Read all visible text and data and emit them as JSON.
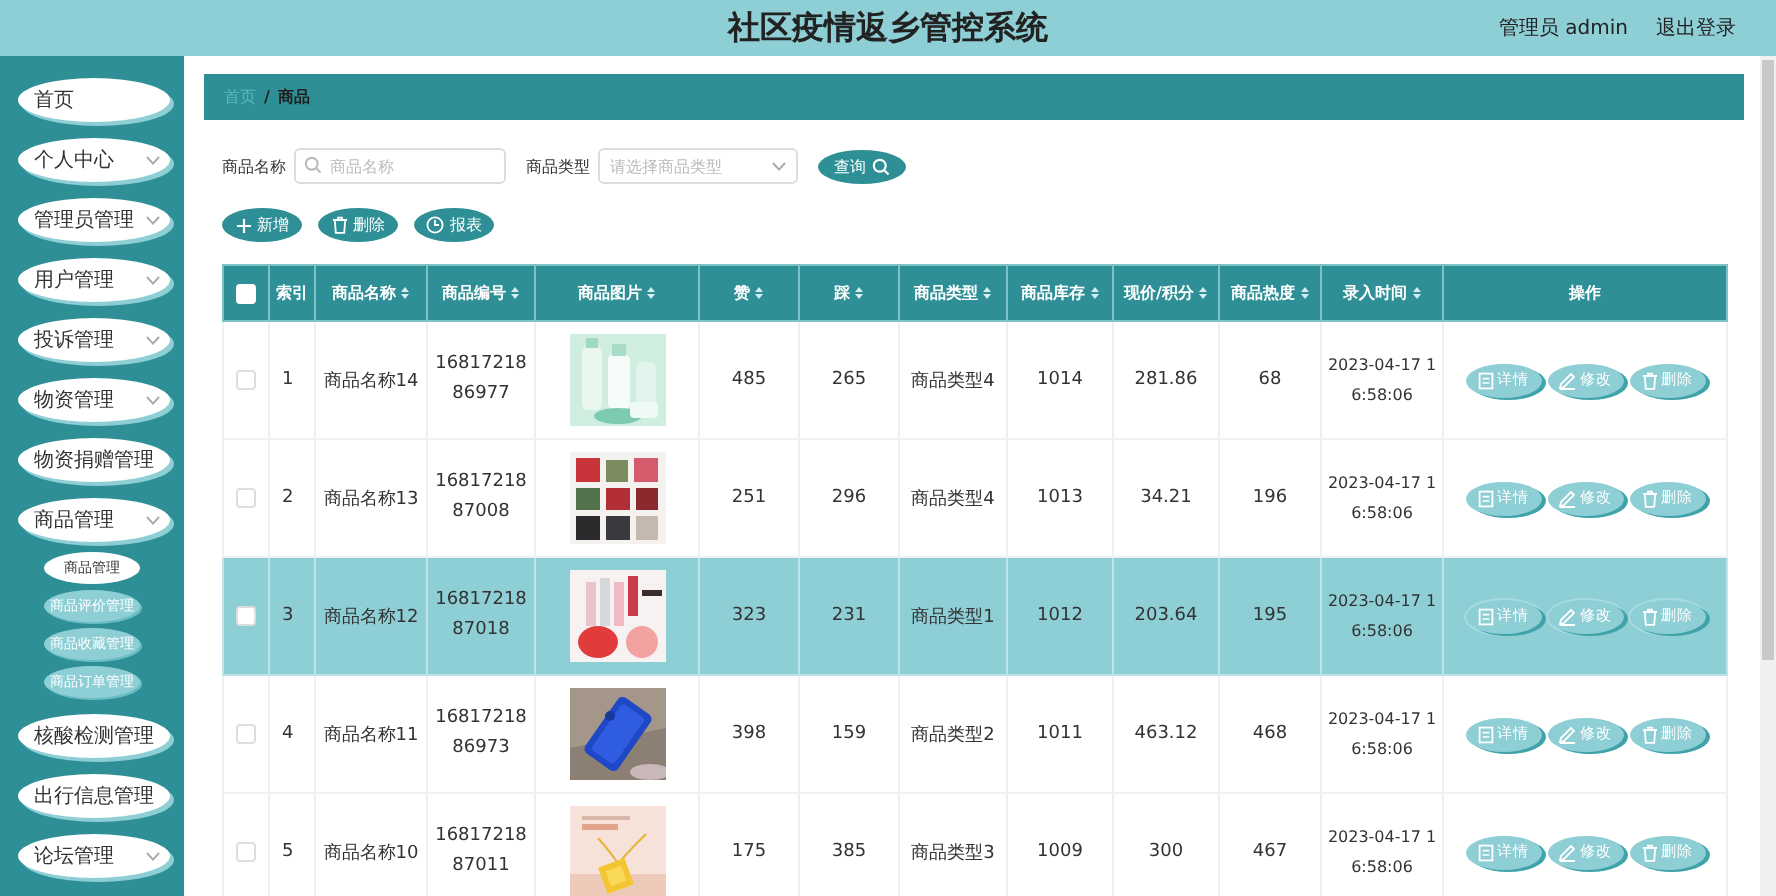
{
  "header": {
    "title": "社区疫情返乡管控系统",
    "user": "管理员 admin",
    "logout": "退出登录"
  },
  "sidebar": {
    "items": [
      {
        "label": "首页",
        "has_submenu": false
      },
      {
        "label": "个人中心",
        "has_submenu": true
      },
      {
        "label": "管理员管理",
        "has_submenu": true
      },
      {
        "label": "用户管理",
        "has_submenu": true
      },
      {
        "label": "投诉管理",
        "has_submenu": true
      },
      {
        "label": "物资管理",
        "has_submenu": true
      },
      {
        "label": "物资捐赠管理",
        "has_submenu": false
      },
      {
        "label": "商品管理",
        "has_submenu": true,
        "children": [
          {
            "label": "商品管理",
            "selected": true
          },
          {
            "label": "商品评价管理",
            "selected": false
          },
          {
            "label": "商品收藏管理",
            "selected": false
          },
          {
            "label": "商品订单管理",
            "selected": false
          }
        ]
      },
      {
        "label": "核酸检测管理",
        "has_submenu": false
      },
      {
        "label": "出行信息管理",
        "has_submenu": false
      },
      {
        "label": "论坛管理",
        "has_submenu": true
      }
    ]
  },
  "breadcrumb": {
    "items": [
      "首页",
      "商品"
    ],
    "separator": "/"
  },
  "search": {
    "name_label": "商品名称",
    "name_placeholder": "商品名称",
    "type_label": "商品类型",
    "type_placeholder": "请选择商品类型",
    "query_button": "查询"
  },
  "toolbar": [
    {
      "kind": "add",
      "label": "新增"
    },
    {
      "kind": "delete",
      "label": "删除"
    },
    {
      "kind": "report",
      "label": "报表"
    }
  ],
  "table": {
    "select_all_checked": false,
    "columns": [
      {
        "label": "索引",
        "sortable": false
      },
      {
        "label": "商品名称",
        "sortable": true
      },
      {
        "label": "商品编号",
        "sortable": true
      },
      {
        "label": "商品图片",
        "sortable": true
      },
      {
        "label": "赞",
        "sortable": true
      },
      {
        "label": "踩",
        "sortable": true
      },
      {
        "label": "商品类型",
        "sortable": true
      },
      {
        "label": "商品库存",
        "sortable": true
      },
      {
        "label": "现价/积分",
        "sortable": true
      },
      {
        "label": "商品热度",
        "sortable": true
      },
      {
        "label": "录入时间",
        "sortable": true
      },
      {
        "label": "操作",
        "sortable": false
      }
    ],
    "rows": [
      {
        "selected": false,
        "checked": false,
        "index": "1",
        "name": "商品名称14",
        "code": "1681721886977",
        "image": {
          "kind": "picture"
        },
        "likes": "485",
        "dislikes": "265",
        "type": "商品类型4",
        "stock": "1014",
        "price": "281.86",
        "heat": "68",
        "time": "2023-04-17 16:58:06",
        "actions": [
          {
            "kind": "view",
            "label": "详情"
          },
          {
            "kind": "edit",
            "label": "修改"
          },
          {
            "kind": "delete",
            "label": "删除"
          }
        ]
      },
      {
        "selected": false,
        "checked": false,
        "index": "2",
        "name": "商品名称13",
        "code": "1681721887008",
        "image": {
          "kind": "picture"
        },
        "likes": "251",
        "dislikes": "296",
        "type": "商品类型4",
        "stock": "1013",
        "price": "34.21",
        "heat": "196",
        "time": "2023-04-17 16:58:06",
        "actions": [
          {
            "kind": "view",
            "label": "详情"
          },
          {
            "kind": "edit",
            "label": "修改"
          },
          {
            "kind": "delete",
            "label": "删除"
          }
        ]
      },
      {
        "selected": true,
        "checked": false,
        "index": "3",
        "name": "商品名称12",
        "code": "1681721887018",
        "image": {
          "kind": "picture"
        },
        "likes": "323",
        "dislikes": "231",
        "type": "商品类型1",
        "stock": "1012",
        "price": "203.64",
        "heat": "195",
        "time": "2023-04-17 16:58:06",
        "actions": [
          {
            "kind": "view",
            "label": "详情"
          },
          {
            "kind": "edit",
            "label": "修改"
          },
          {
            "kind": "delete",
            "label": "删除"
          }
        ]
      },
      {
        "selected": false,
        "checked": false,
        "index": "4",
        "name": "商品名称11",
        "code": "1681721886973",
        "image": {
          "kind": "picture"
        },
        "likes": "398",
        "dislikes": "159",
        "type": "商品类型2",
        "stock": "1011",
        "price": "463.12",
        "heat": "468",
        "time": "2023-04-17 16:58:06",
        "actions": [
          {
            "kind": "view",
            "label": "详情"
          },
          {
            "kind": "edit",
            "label": "修改"
          },
          {
            "kind": "delete",
            "label": "删除"
          }
        ]
      },
      {
        "selected": false,
        "checked": false,
        "index": "5",
        "name": "商品名称10",
        "code": "1681721887011",
        "image": {
          "kind": "picture"
        },
        "likes": "175",
        "dislikes": "385",
        "type": "商品类型3",
        "stock": "1009",
        "price": "300",
        "heat": "467",
        "time": "2023-04-17 16:58:06",
        "actions": [
          {
            "kind": "view",
            "label": "详情"
          },
          {
            "kind": "edit",
            "label": "修改"
          },
          {
            "kind": "delete",
            "label": "删除"
          }
        ]
      }
    ]
  }
}
